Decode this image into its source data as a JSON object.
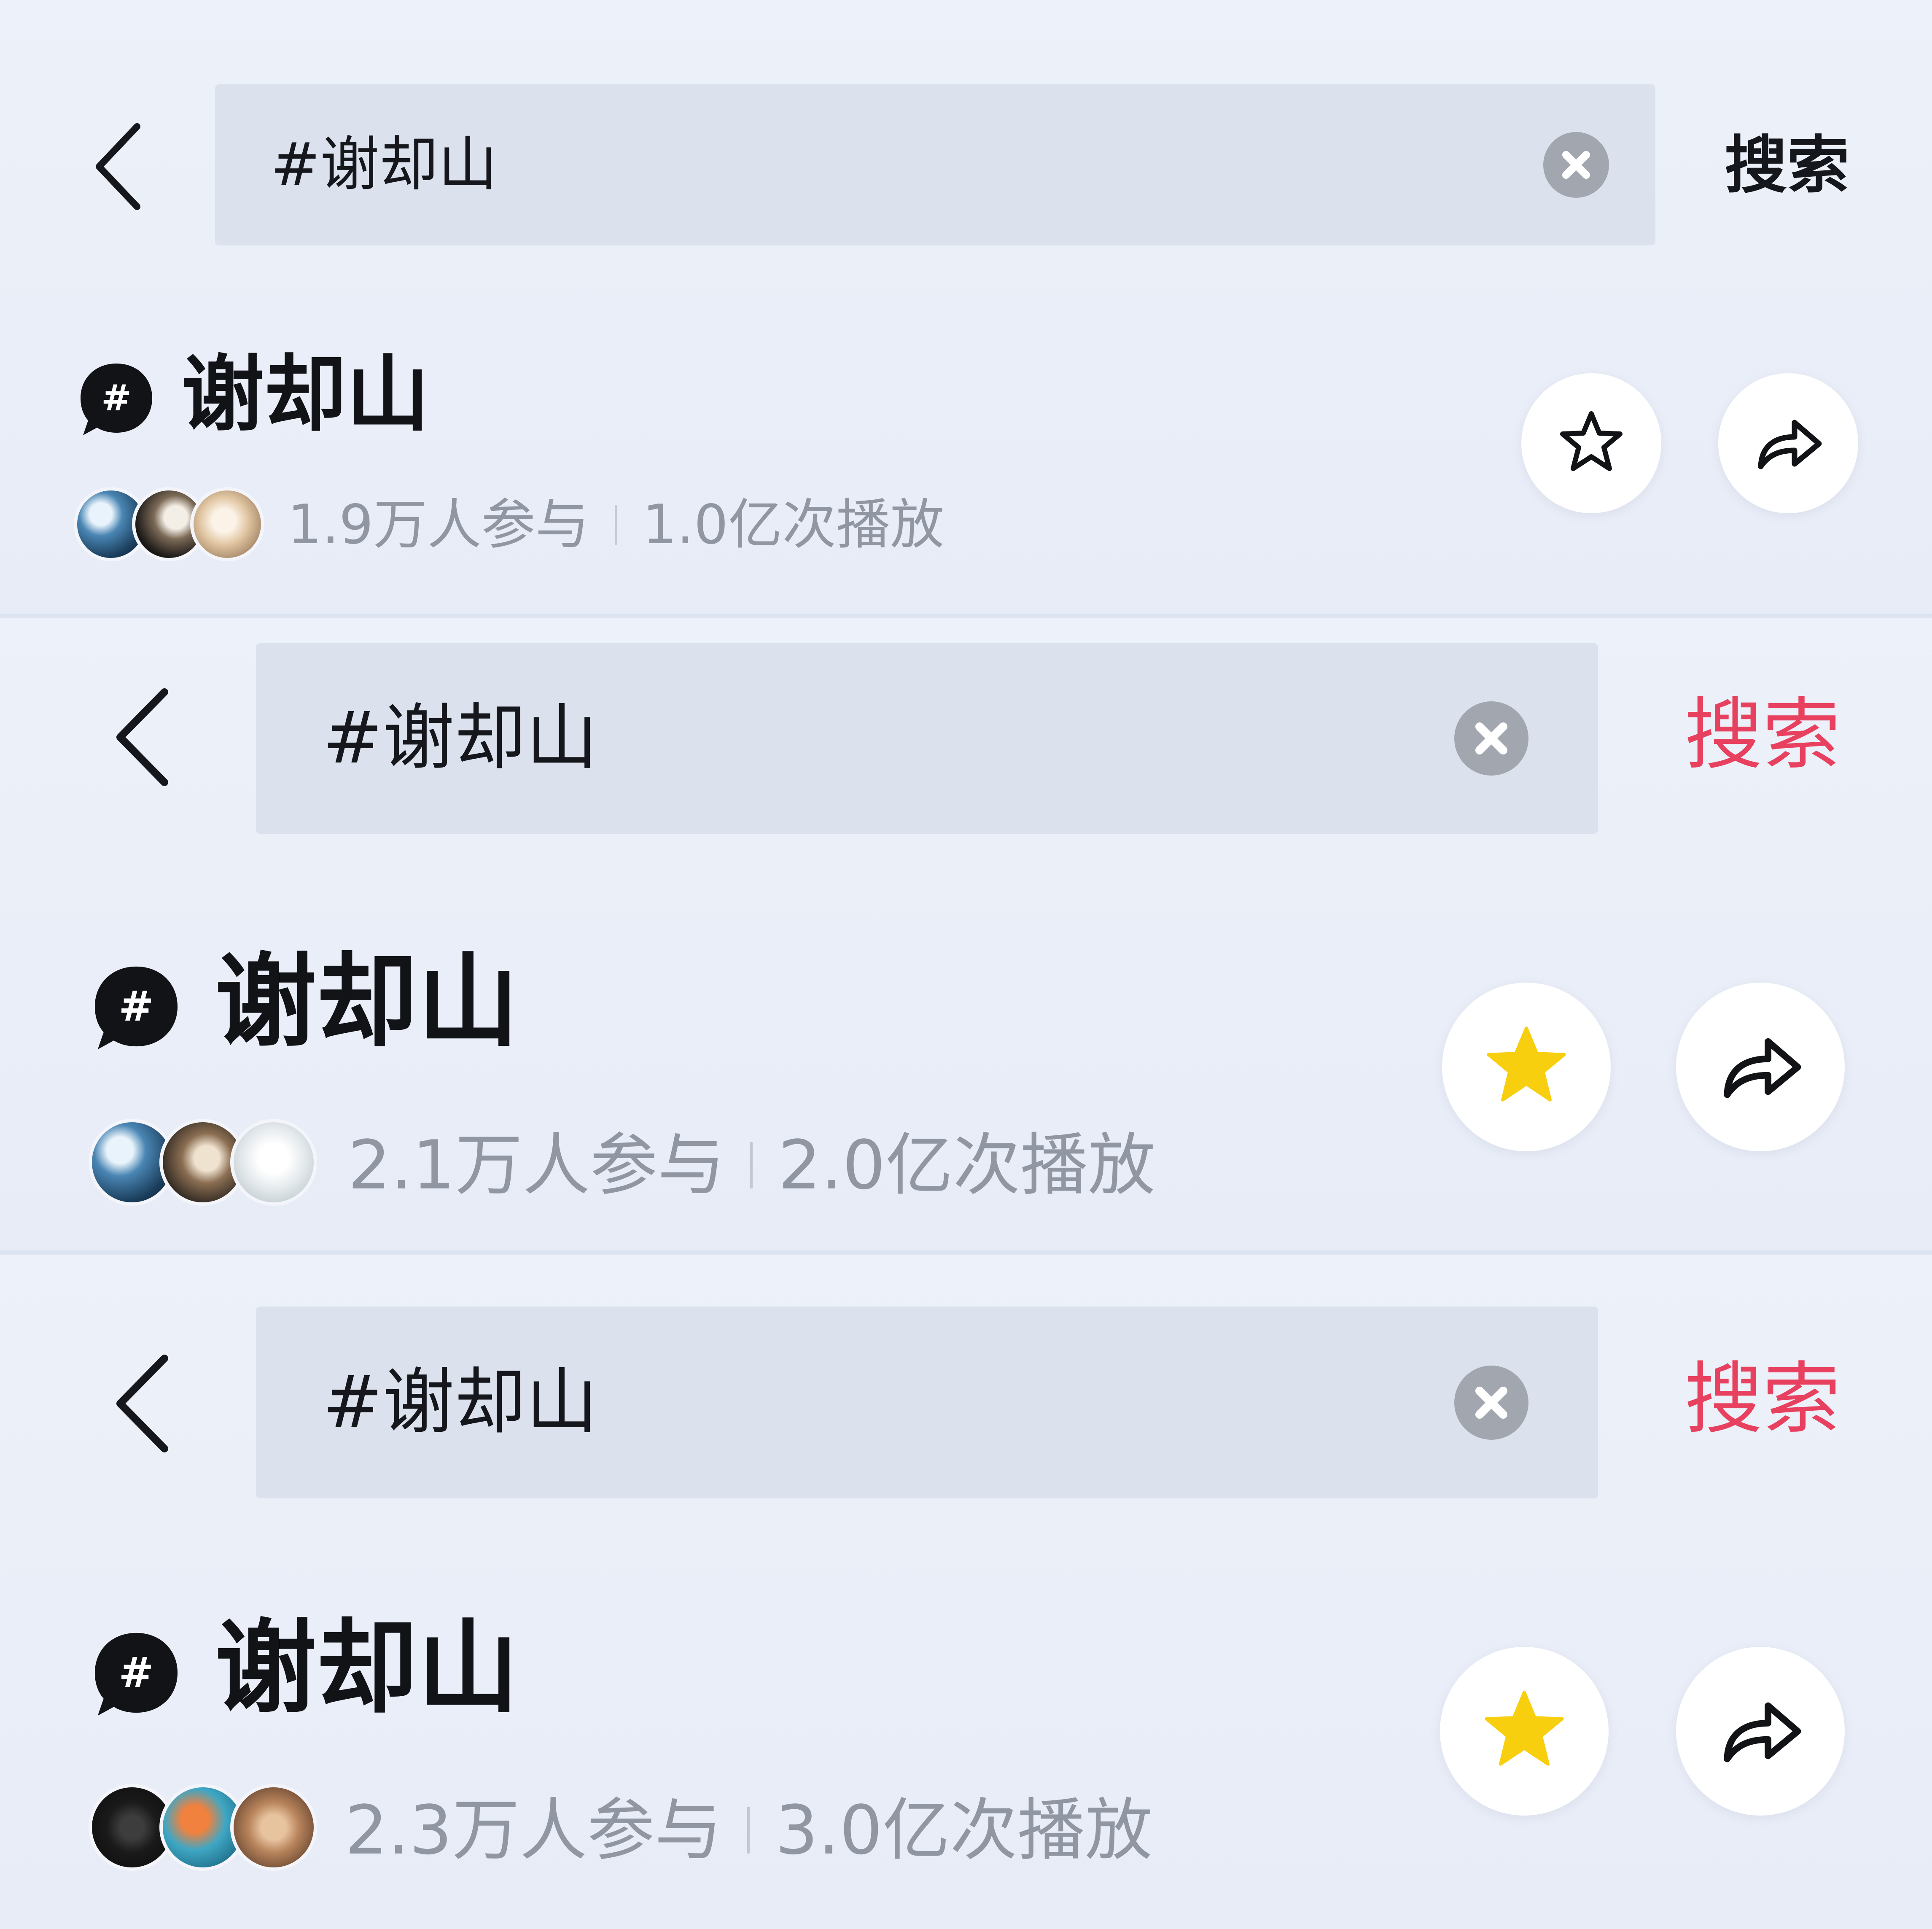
{
  "colors": {
    "background": "#e9eef8",
    "search_field": "#dce2ed",
    "search_label_dark": "#15171c",
    "search_label_accent": "#e8405f",
    "star_active": "#f8cf0f",
    "stats_text": "#9096a2"
  },
  "panels": [
    {
      "back_icon": "chevron-left-icon",
      "search_query": "#谢却山",
      "clear_icon": "clear-circle-icon",
      "search_label": "搜索",
      "search_label_style": "dark",
      "topic_icon": "hashtag-bubble-icon",
      "topic_title": "谢却山",
      "avatars": [
        "avatar-1",
        "avatar-2",
        "avatar-3"
      ],
      "participants": "1.9万人参与",
      "plays": "1.0亿次播放",
      "favorite_icon": "star-outline-icon",
      "favorited": false,
      "share_icon": "share-arrow-icon"
    },
    {
      "back_icon": "chevron-left-icon",
      "search_query": "#谢却山",
      "clear_icon": "clear-circle-icon",
      "search_label": "搜索",
      "search_label_style": "accent",
      "topic_icon": "hashtag-bubble-icon",
      "topic_title": "谢却山",
      "avatars": [
        "avatar-1",
        "avatar-2",
        "avatar-3"
      ],
      "participants": "2.1万人参与",
      "plays": "2.0亿次播放",
      "favorite_icon": "star-filled-icon",
      "favorited": true,
      "share_icon": "share-arrow-icon"
    },
    {
      "back_icon": "chevron-left-icon",
      "search_query": "#谢却山",
      "clear_icon": "clear-circle-icon",
      "search_label": "搜索",
      "search_label_style": "accent",
      "topic_icon": "hashtag-bubble-icon",
      "topic_title": "谢却山",
      "avatars": [
        "avatar-1",
        "avatar-2",
        "avatar-3"
      ],
      "participants": "2.3万人参与",
      "plays": "3.0亿次播放",
      "favorite_icon": "star-filled-icon",
      "favorited": true,
      "share_icon": "share-arrow-icon"
    }
  ]
}
